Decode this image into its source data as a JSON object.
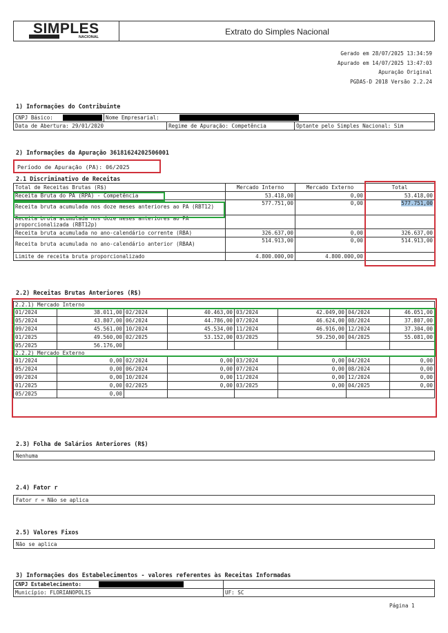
{
  "header": {
    "logo_text": "SIMPLES",
    "logo_sub": "NACIONAL",
    "title": "Extrato do Simples Nacional",
    "meta": [
      "Gerado em 28/07/2025 13:34:59",
      "Apurado em 14/07/2025 13:47:03",
      "Apuração Original",
      "PGDAS-D 2018 Versão 2.2.24"
    ]
  },
  "contrib": {
    "title": "1) Informações do Contribuinte",
    "cnpj_label": "CNPJ Básico:",
    "nome_label": "Nome Empresarial:",
    "abertura": "Data de Abertura: 29/01/2020",
    "regime": "Regime de Apuração: Competência",
    "optante": "Optante pelo Simples Nacional: Sim"
  },
  "apuracao": {
    "title": "2) Informações da Apuração 36181624202506001",
    "periodo": "Período de Apuração (PA): 06/2025",
    "sub_title": "2.1 Discriminativo de Receitas",
    "headers": [
      "Total de Receitas Brutas (R$)",
      "Mercado Interno",
      "Mercado Externo",
      "Total"
    ],
    "rows": [
      {
        "label": "Receita Bruta do PA (RPA) - Competência",
        "mi": "53.418,00",
        "me": "0,00",
        "total": "53.418,00"
      },
      {
        "label": "Receita bruta acumulada nos doze meses anteriores ao PA (RBT12)",
        "mi": "577.751,00",
        "me": "0,00",
        "total": "577.751,00"
      },
      {
        "label": "Receita bruta acumulada nos doze meses anteriores ao PA proporcionalizada (RBT12p)",
        "mi": "",
        "me": "",
        "total": ""
      },
      {
        "label": "Receita bruta acumulada no ano-calendário corrente (RBA)",
        "mi": "326.637,00",
        "me": "0,00",
        "total": "326.637,00"
      },
      {
        "label": "Receita bruta acumulada no ano-calendário anterior (RBAA)",
        "mi": "514.913,00",
        "me": "0,00",
        "total": "514.913,00"
      },
      {
        "label": "Limite de receita bruta proporcionalizado",
        "mi": "4.800.000,00",
        "me": "4.800.000,00",
        "total": ""
      }
    ]
  },
  "anteriores": {
    "title": "2.2) Receitas Brutas Anteriores (R$)",
    "interno_label": "2.2.1) Mercado Interno",
    "interno_rows": [
      [
        "01/2024",
        "38.011,00",
        "02/2024",
        "40.463,00",
        "03/2024",
        "42.049,00",
        "04/2024",
        "46.051,00"
      ],
      [
        "05/2024",
        "43.807,00",
        "06/2024",
        "44.786,00",
        "07/2024",
        "46.624,00",
        "08/2024",
        "37.807,00"
      ],
      [
        "09/2024",
        "45.561,00",
        "10/2024",
        "45.534,00",
        "11/2024",
        "46.916,00",
        "12/2024",
        "37.304,00"
      ],
      [
        "01/2025",
        "49.560,00",
        "02/2025",
        "53.152,00",
        "03/2025",
        "59.250,00",
        "04/2025",
        "55.081,00"
      ],
      [
        "05/2025",
        "56.176,00",
        "",
        "",
        "",
        "",
        "",
        ""
      ]
    ],
    "externo_label": "2.2.2) Mercado Externo",
    "externo_rows": [
      [
        "01/2024",
        "0,00",
        "02/2024",
        "0,00",
        "03/2024",
        "0,00",
        "04/2024",
        "0,00"
      ],
      [
        "05/2024",
        "0,00",
        "06/2024",
        "0,00",
        "07/2024",
        "0,00",
        "08/2024",
        "0,00"
      ],
      [
        "09/2024",
        "0,00",
        "10/2024",
        "0,00",
        "11/2024",
        "0,00",
        "12/2024",
        "0,00"
      ],
      [
        "01/2025",
        "0,00",
        "02/2025",
        "0,00",
        "03/2025",
        "0,00",
        "04/2025",
        "0,00"
      ],
      [
        "05/2025",
        "0,00",
        "",
        "",
        "",
        "",
        "",
        ""
      ]
    ]
  },
  "folha": {
    "title": "2.3) Folha de Salários Anteriores (R$)",
    "value": "Nenhuma"
  },
  "fator": {
    "title": "2.4) Fator r",
    "value": "Fator r = Não se aplica"
  },
  "fixos": {
    "title": "2.5) Valores Fixos",
    "value": "Não se aplica"
  },
  "estab": {
    "title": "3) Informações dos Estabelecimentos - valores referentes às Receitas Informadas",
    "cnpj_label": "CNPJ Estabelecimento:",
    "municipio": "Município: FLORIANOPOLIS",
    "uf": "UF: SC"
  },
  "footer": {
    "page": "Página 1"
  },
  "colors": {
    "red": "#d0303a",
    "green": "#27a33b",
    "highlight": "#a8c9e6"
  }
}
